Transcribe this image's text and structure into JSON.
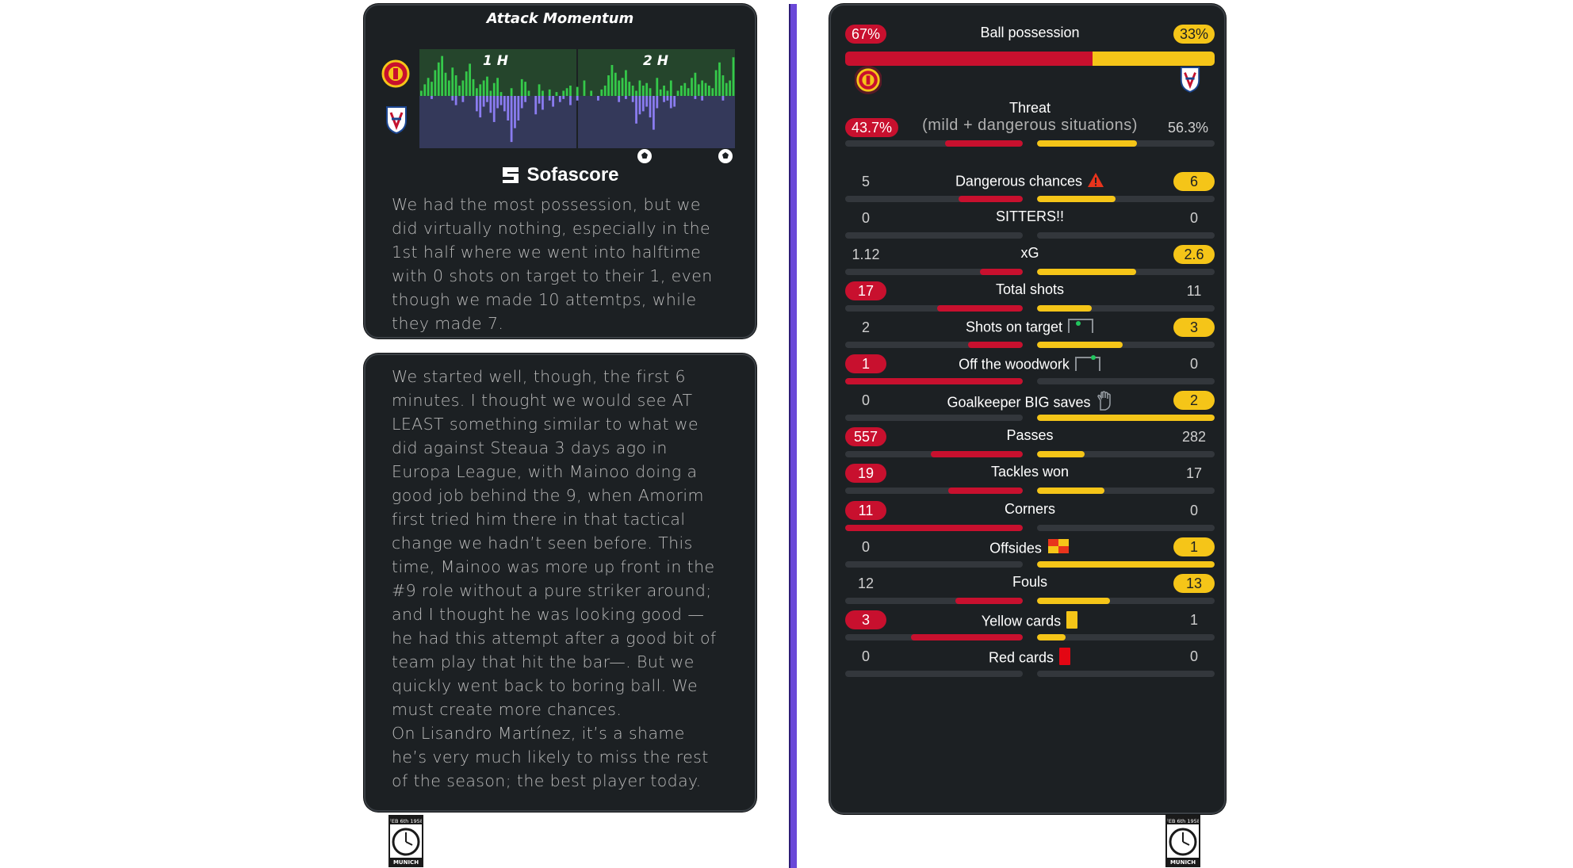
{
  "momentum": {
    "title": "Attack Momentum",
    "half_labels": [
      "1 H",
      "2 H"
    ],
    "brand": "Sofascore",
    "home_values": [
      4,
      9,
      14,
      11,
      20,
      26,
      31,
      18,
      12,
      22,
      16,
      8,
      12,
      19,
      25,
      13,
      6,
      9,
      12,
      15,
      4,
      10,
      14,
      3,
      0,
      0,
      6,
      0,
      0,
      13,
      11,
      4,
      0,
      0,
      9,
      4,
      0,
      5,
      0,
      3,
      0,
      4,
      6,
      8,
      0,
      7,
      0,
      12,
      0,
      4,
      0,
      0,
      5,
      8,
      16,
      24,
      18,
      12,
      14,
      20,
      11,
      8,
      4,
      12,
      8,
      10,
      6,
      0,
      14,
      5,
      8,
      4,
      12,
      0,
      4,
      8,
      10,
      6,
      14,
      18,
      9,
      12,
      10,
      8,
      6,
      20,
      26,
      16,
      10,
      12,
      30
    ],
    "away_values": [
      0,
      0,
      0,
      2,
      0,
      0,
      0,
      0,
      0,
      3,
      6,
      0,
      4,
      0,
      0,
      0,
      10,
      14,
      7,
      4,
      11,
      17,
      8,
      6,
      10,
      16,
      30,
      21,
      16,
      8,
      4,
      0,
      0,
      12,
      5,
      9,
      0,
      3,
      7,
      0,
      4,
      2,
      0,
      6,
      0,
      3,
      0,
      0,
      0,
      0,
      0,
      3,
      0,
      0,
      0,
      0,
      0,
      4,
      0,
      2,
      0,
      4,
      18,
      12,
      10,
      7,
      14,
      22,
      8,
      0,
      4,
      3,
      8,
      7,
      0,
      0,
      0,
      0,
      0,
      2,
      0,
      3,
      0,
      0,
      0,
      0,
      0,
      3,
      0,
      0,
      0
    ],
    "goal_markers_label": "goal",
    "caption": "We had the most possession, but we did virtually nothing, especially in the 1st half where we went into halftime with 0 shots on target to their 1, even though we made 10 attemtps, while they made 7."
  },
  "commentary": {
    "text": "We started well, though, the first 6 minutes. I thought we would see AT LEAST something similar to what we did against Steaua 3 days ago in Europa League, with Mainoo doing a good job behind the 9, when Amorim first tried him there in that tactical change we hadn’t seen before. This time, Mainoo was more up front in the #9 role without a pure striker around; and I thought he was looking good — he had this attempt after a good bit of team play that hit the bar—. But we quickly went back to boring ball. We must create more chances.\nOn Lisandro Martínez, it’s a shame he’s very much likely to miss the rest of the season; the best player today."
  },
  "stats": {
    "possession": {
      "label": "Ball possession",
      "home": "67%",
      "away": "33%",
      "home_share": 0.67
    },
    "threat": {
      "label": "Threat",
      "sublabel": "(mild + dangerous situations)",
      "home": "43.7%",
      "away": "56.3%",
      "home_share": 0.437,
      "away_share": 0.563
    },
    "rows": [
      {
        "label": "Dangerous chances",
        "home": "5",
        "away": "6",
        "leader": "away",
        "home_frac": 0.36,
        "away_frac": 0.44,
        "icon": "warning-icon"
      },
      {
        "label": "SITTERS!!",
        "home": "0",
        "away": "0",
        "leader": "none",
        "home_frac": 0,
        "away_frac": 0,
        "icon": ""
      },
      {
        "label": "xG",
        "home": "1.12",
        "away": "2.6",
        "leader": "away",
        "home_frac": 0.24,
        "away_frac": 0.56,
        "icon": ""
      },
      {
        "label": "Total shots",
        "home": "17",
        "away": "11",
        "leader": "home",
        "home_frac": 0.48,
        "away_frac": 0.31,
        "icon": ""
      },
      {
        "label": "Shots on target",
        "home": "2",
        "away": "3",
        "leader": "away",
        "home_frac": 0.31,
        "away_frac": 0.48,
        "icon": "goal-net-icon"
      },
      {
        "label": "Off the woodwork",
        "home": "1",
        "away": "0",
        "leader": "home",
        "home_frac": 1,
        "away_frac": 0,
        "icon": "woodwork-icon"
      },
      {
        "label": "Goalkeeper BIG saves",
        "home": "0",
        "away": "2",
        "leader": "away",
        "home_frac": 0,
        "away_frac": 1,
        "icon": "goalkeeper-glove-icon"
      },
      {
        "label": "Passes",
        "home": "557",
        "away": "282",
        "leader": "home",
        "home_frac": 0.52,
        "away_frac": 0.27,
        "icon": ""
      },
      {
        "label": "Tackles won",
        "home": "19",
        "away": "17",
        "leader": "home",
        "home_frac": 0.42,
        "away_frac": 0.38,
        "icon": ""
      },
      {
        "label": "Corners",
        "home": "11",
        "away": "0",
        "leader": "home",
        "home_frac": 1,
        "away_frac": 0,
        "icon": ""
      },
      {
        "label": "Offsides",
        "home": "0",
        "away": "1",
        "leader": "away",
        "home_frac": 0,
        "away_frac": 1,
        "icon": "offside-flag-icon"
      },
      {
        "label": "Fouls",
        "home": "12",
        "away": "13",
        "leader": "away",
        "home_frac": 0.38,
        "away_frac": 0.41,
        "icon": ""
      },
      {
        "label": "Yellow cards",
        "home": "3",
        "away": "1",
        "leader": "home",
        "home_frac": 0.63,
        "away_frac": 0.16,
        "icon": "yellow-card-icon"
      },
      {
        "label": "Red cards",
        "home": "0",
        "away": "0",
        "leader": "none",
        "home_frac": 0,
        "away_frac": 0,
        "icon": "red-card-icon"
      }
    ]
  },
  "teams": {
    "home_crest": "manchester-united-crest",
    "away_crest": "crystal-palace-crest"
  },
  "memorial": {
    "date": "FEB 6th 1958",
    "city": "MUNICH"
  },
  "colors": {
    "home": "#c8102e",
    "away": "#f5c518",
    "card_bg": "#1c2023",
    "divider": "#6a48d8"
  }
}
